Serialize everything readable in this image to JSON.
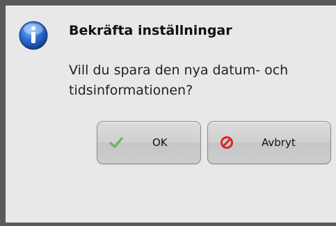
{
  "dialog": {
    "title": "Bekräfta inställningar",
    "message": "Vill du spara den nya datum- och tidsinformationen?",
    "icon": "info-icon"
  },
  "buttons": {
    "ok": {
      "label": "OK",
      "icon": "checkmark-icon",
      "icon_color": "#5cb85c"
    },
    "cancel": {
      "label": "Avbryt",
      "icon": "cancel-icon",
      "icon_color": "#d9262a"
    }
  },
  "colors": {
    "dialog_background": "#e8e8e8",
    "frame": "#5a5a5a",
    "info_icon_blue": "#1f5fb8"
  }
}
